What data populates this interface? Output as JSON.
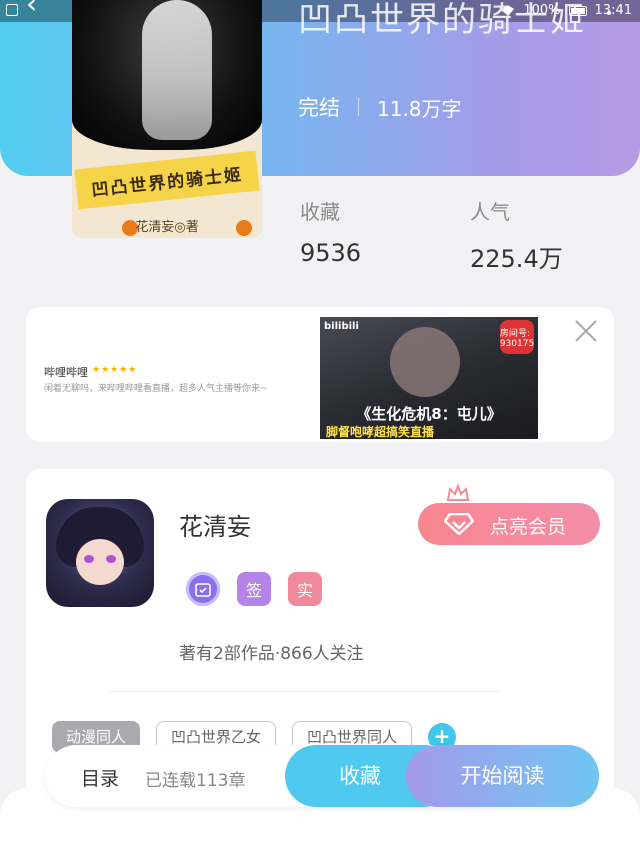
{
  "status_bar": {
    "battery": "100%",
    "time": "13:41"
  },
  "book": {
    "title": "凹凸世界的骑士姬",
    "status": "完结",
    "word_count": "11.8万字",
    "cover_title": "凹凸世界的骑士姬",
    "cover_author": "花清妄◎著",
    "stats": {
      "favorites_label": "收藏",
      "favorites_value": "9536",
      "popularity_label": "人气",
      "popularity_value": "225.4万"
    }
  },
  "ad": {
    "app_name": "哔哩哔哩",
    "stars": "★★★★★",
    "description": "闲着无聊吗，来哔哩哔哩看直播，超多人气主播等你来~",
    "media_logo": "bilibili",
    "media_badge": "房间号: 930175",
    "caption_line1": "《生化危机8：屯儿》",
    "caption_line2": "脚督咆哮超搞笑直播"
  },
  "author": {
    "name": "花清妄",
    "vip_button": "点亮会员",
    "badges": [
      "",
      "签",
      "实"
    ],
    "works_summary": "著有2部作品·866人关注",
    "tags": [
      "动漫同人",
      "凹凸世界乙女",
      "凹凸世界同人"
    ],
    "add_tag": "+"
  },
  "bottom_bar": {
    "toc_label": "目录",
    "chapters": "已连载113章",
    "collect_button": "收藏",
    "read_button": "开始阅读"
  },
  "colors": {
    "hero_gradient_start": "#52cdf0",
    "hero_gradient_end": "#b59ae6",
    "collect_blue": "#4fc9ef",
    "vip_pink": "#f7868f"
  }
}
